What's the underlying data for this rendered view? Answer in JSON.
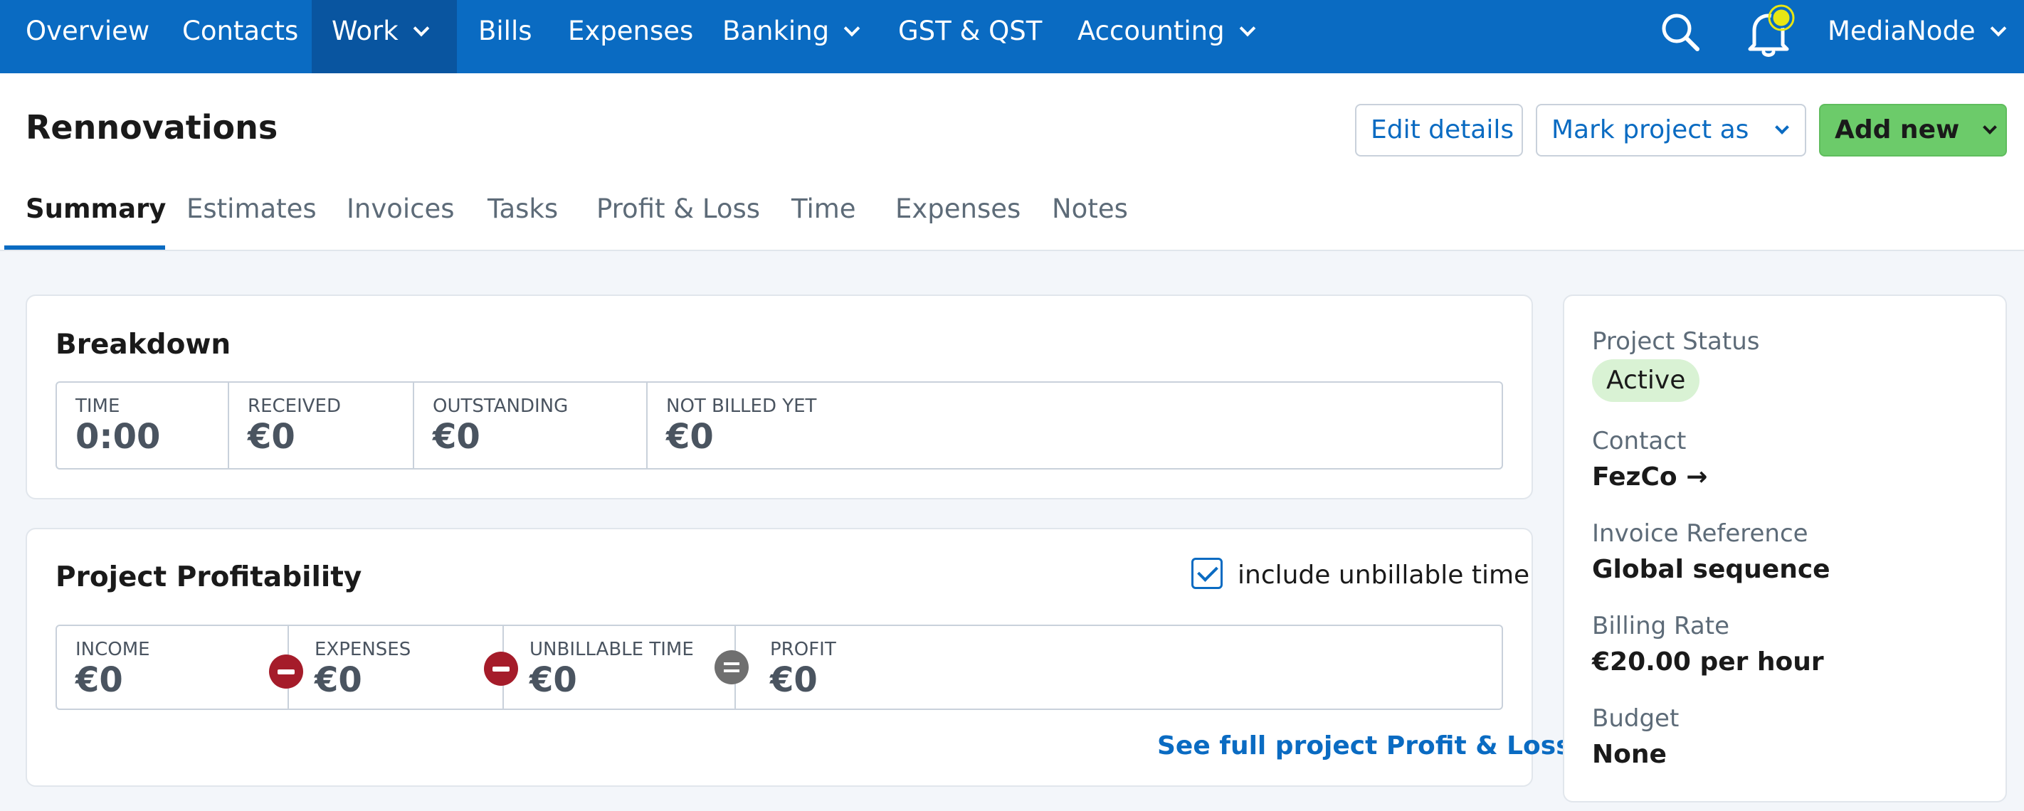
{
  "nav": {
    "items": [
      {
        "label": "Overview"
      },
      {
        "label": "Contacts"
      },
      {
        "label": "Work"
      },
      {
        "label": "Bills"
      },
      {
        "label": "Expenses"
      },
      {
        "label": "Banking"
      },
      {
        "label": "GST & QST"
      },
      {
        "label": "Accounting"
      }
    ],
    "active": "Work",
    "account": "MediaNode",
    "icons": {
      "search": "search-icon",
      "notifications": "bell-icon"
    },
    "bar_color": "#0a6bc2"
  },
  "page": {
    "title": "Rennovations",
    "buttons": {
      "edit": "Edit details",
      "mark": "Mark project as",
      "add": "Add new"
    },
    "tabs": [
      "Summary",
      "Estimates",
      "Invoices",
      "Tasks",
      "Profit & Loss",
      "Time",
      "Expenses",
      "Notes"
    ],
    "active_tab": "Summary"
  },
  "breakdown": {
    "title": "Breakdown",
    "stats": [
      {
        "label": "TIME",
        "value": "0:00"
      },
      {
        "label": "RECEIVED",
        "value": "€0"
      },
      {
        "label": "OUTSTANDING",
        "value": "€0"
      },
      {
        "label": "NOT BILLED YET",
        "value": "€0"
      }
    ]
  },
  "profitability": {
    "title": "Project Profitability",
    "include_unbillable_label": "include unbillable time",
    "include_unbillable_checked": true,
    "stats": [
      {
        "label": "INCOME",
        "value": "€0"
      },
      {
        "label": "EXPENSES",
        "value": "€0"
      },
      {
        "label": "UNBILLABLE TIME",
        "value": "€0"
      },
      {
        "label": "PROFIT",
        "value": "€0"
      }
    ],
    "link": "See full project Profit & Loss"
  },
  "sidebar": {
    "status_label": "Project Status",
    "status_value": "Active",
    "contact_label": "Contact",
    "contact_value": "FezCo →",
    "invoice_ref_label": "Invoice Reference",
    "invoice_ref_value": "Global sequence",
    "billing_rate_label": "Billing Rate",
    "billing_rate_value": "€20.00 per hour",
    "budget_label": "Budget",
    "budget_value": "None"
  }
}
